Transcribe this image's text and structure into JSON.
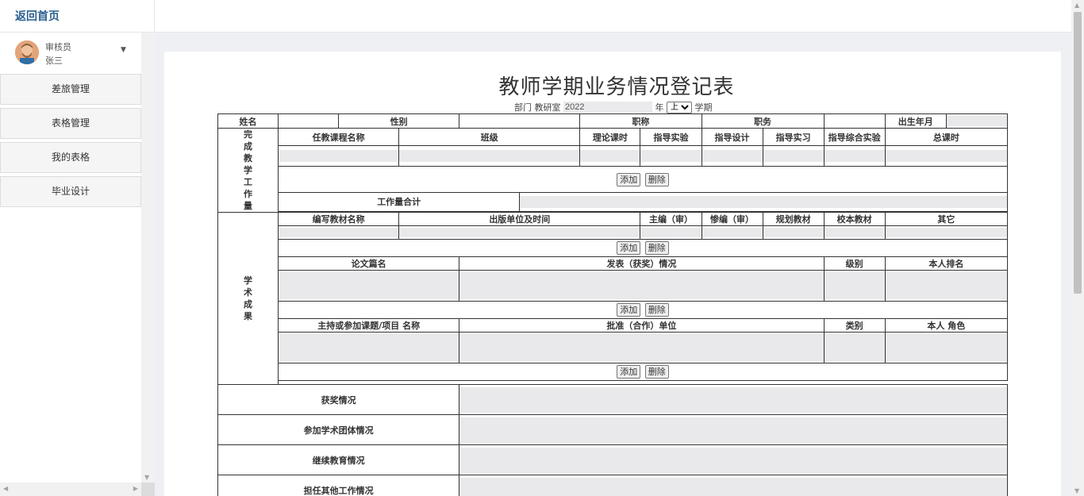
{
  "header": {
    "back_home": "返回首页"
  },
  "user": {
    "role": "审核员",
    "name": "张三",
    "avatar_icon": "user-avatar"
  },
  "sidebar": {
    "items": [
      {
        "label": "差旅管理"
      },
      {
        "label": "表格管理"
      },
      {
        "label": "我的表格"
      },
      {
        "label": "毕业设计"
      }
    ]
  },
  "form": {
    "title": "教师学期业务情况登记表",
    "dept_label": "部门",
    "dept_value": "教研室",
    "year_value": "2022",
    "year_label": "年",
    "term_selected": "上",
    "term_label": "学期",
    "basic": {
      "name": "姓名",
      "gender": "性别",
      "title": "职称",
      "duty": "职务",
      "birth": "出生年月"
    },
    "workload": {
      "section_label": "完成教学工作量",
      "cols": [
        "任教课程名称",
        "班级",
        "理论课时",
        "指导实验",
        "指导设计",
        "指导实习",
        "指导综合实验",
        "总课时"
      ],
      "total_label": "工作量合计"
    },
    "academic": {
      "section_label": "学术成果",
      "textbook_cols": [
        "编写教材名称",
        "出版单位及时间",
        "主编（审）",
        "惨编（审）",
        "规划教材",
        "校本教材",
        "其它"
      ],
      "paper_cols": [
        "论文篇名",
        "发表（获奖）情况",
        "级别",
        "本人排名"
      ],
      "project_cols": [
        "主持或参加课题/项目 名称",
        "批准（合作）单位",
        "类别",
        "本人 角色"
      ]
    },
    "add_label": "添加",
    "delete_label": "删除",
    "extra": {
      "awards": "获奖情况",
      "groups": "参加学术团体情况",
      "education": "继续教育情况",
      "other_work": "担任其他工作情况"
    }
  }
}
